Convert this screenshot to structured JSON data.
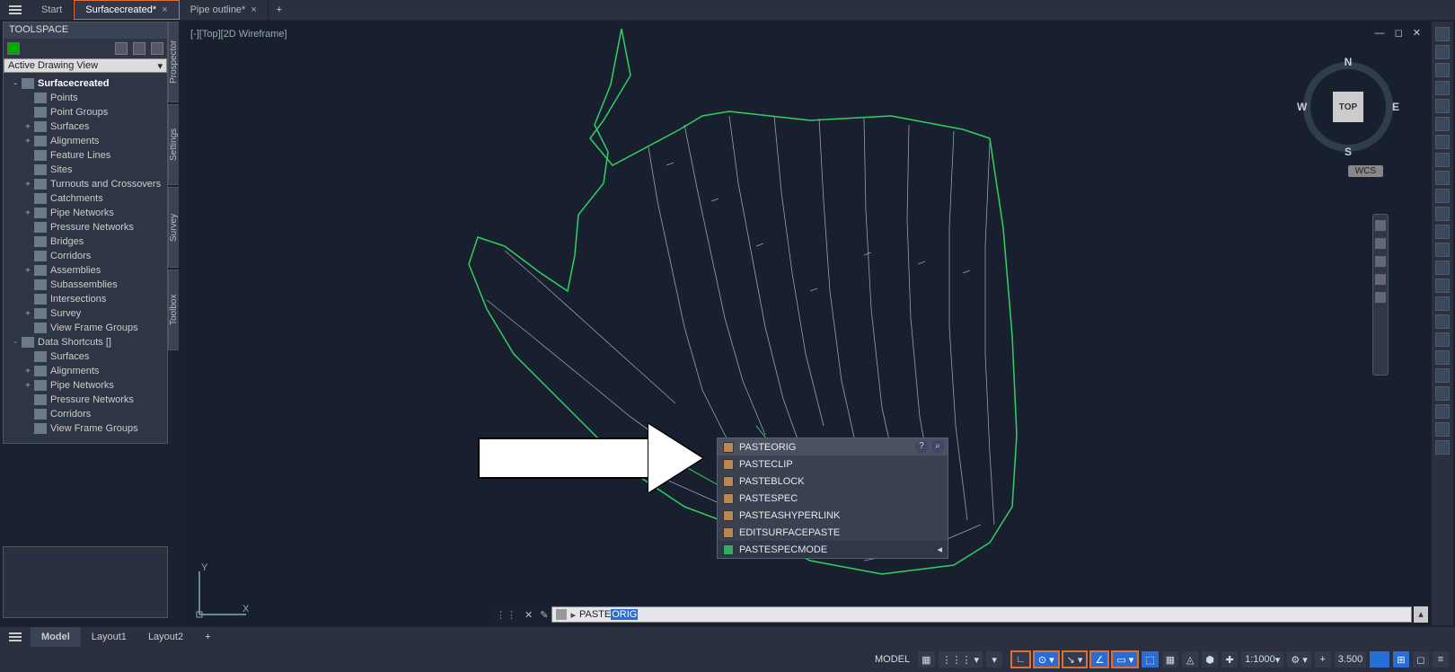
{
  "tabs": {
    "start": "Start",
    "t1": "Surfacecreated*",
    "t2": "Pipe outline*"
  },
  "toolspace": {
    "title": "TOOLSPACE",
    "view_dd": "Active Drawing View",
    "side_tabs": [
      "Prospector",
      "Settings",
      "Survey",
      "Toolbox"
    ],
    "tree": [
      {
        "d": 0,
        "exp": "-",
        "label": "Surfacecreated",
        "bold": true
      },
      {
        "d": 1,
        "exp": "",
        "label": "Points"
      },
      {
        "d": 1,
        "exp": "",
        "label": "Point Groups"
      },
      {
        "d": 1,
        "exp": "+",
        "label": "Surfaces"
      },
      {
        "d": 1,
        "exp": "+",
        "label": "Alignments"
      },
      {
        "d": 1,
        "exp": "",
        "label": "Feature Lines"
      },
      {
        "d": 1,
        "exp": "",
        "label": "Sites"
      },
      {
        "d": 1,
        "exp": "+",
        "label": "Turnouts and Crossovers"
      },
      {
        "d": 1,
        "exp": "",
        "label": "Catchments"
      },
      {
        "d": 1,
        "exp": "+",
        "label": "Pipe Networks"
      },
      {
        "d": 1,
        "exp": "",
        "label": "Pressure Networks"
      },
      {
        "d": 1,
        "exp": "",
        "label": "Bridges"
      },
      {
        "d": 1,
        "exp": "",
        "label": "Corridors"
      },
      {
        "d": 1,
        "exp": "+",
        "label": "Assemblies"
      },
      {
        "d": 1,
        "exp": "",
        "label": "Subassemblies"
      },
      {
        "d": 1,
        "exp": "",
        "label": "Intersections"
      },
      {
        "d": 1,
        "exp": "+",
        "label": "Survey"
      },
      {
        "d": 1,
        "exp": "",
        "label": "View Frame Groups"
      },
      {
        "d": 0,
        "exp": "-",
        "label": "Data Shortcuts []"
      },
      {
        "d": 1,
        "exp": "",
        "label": "Surfaces"
      },
      {
        "d": 1,
        "exp": "+",
        "label": "Alignments"
      },
      {
        "d": 1,
        "exp": "+",
        "label": "Pipe Networks"
      },
      {
        "d": 1,
        "exp": "",
        "label": "Pressure Networks"
      },
      {
        "d": 1,
        "exp": "",
        "label": "Corridors"
      },
      {
        "d": 1,
        "exp": "",
        "label": "View Frame Groups"
      }
    ]
  },
  "viewport": {
    "label": "[-][Top][2D Wireframe]",
    "cube_face": "TOP",
    "n": "N",
    "s": "S",
    "e": "E",
    "w": "W",
    "wcs": "WCS"
  },
  "ucs": {
    "y": "Y",
    "x": "X"
  },
  "autocomplete": {
    "items": [
      "PASTEORIG",
      "PASTECLIP",
      "PASTEBLOCK",
      "PASTESPEC",
      "PASTEASHYPERLINK",
      "EDITSURFACEPASTE",
      "PASTESPECMODE"
    ]
  },
  "command": {
    "typed": "PASTE",
    "completion": "ORIG"
  },
  "layout_tabs": {
    "model": "Model",
    "l1": "Layout1",
    "l2": "Layout2"
  },
  "status": {
    "model": "MODEL",
    "scale": "1:1000",
    "val": "3.500"
  }
}
